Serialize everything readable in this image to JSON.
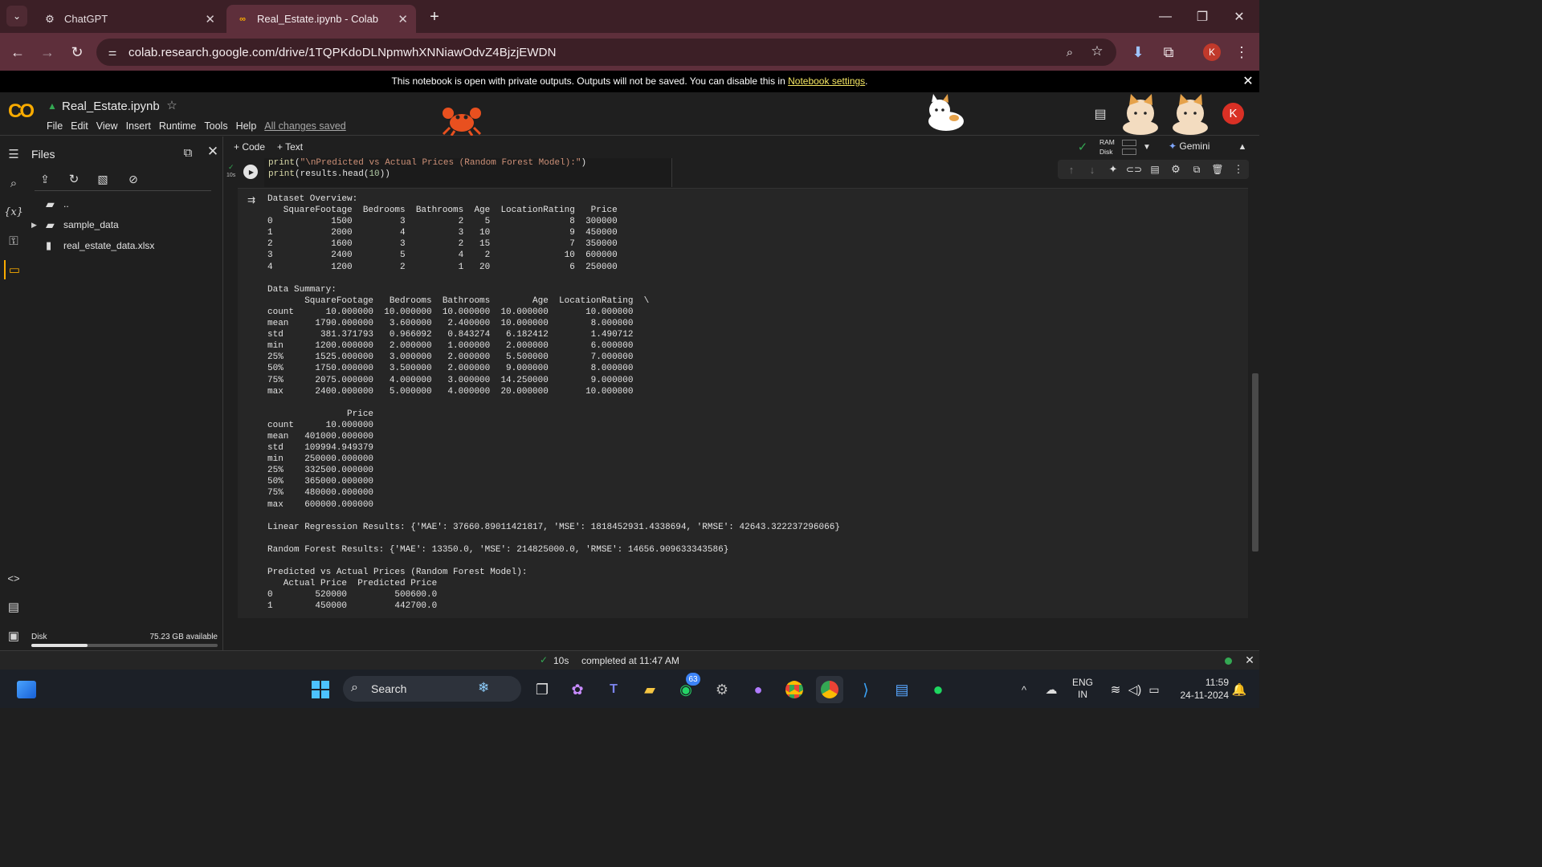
{
  "browser": {
    "tabs": [
      {
        "title": "ChatGPT",
        "active": false
      },
      {
        "title": "Real_Estate.ipynb - Colab",
        "active": true
      }
    ],
    "url": "colab.research.google.com/drive/1TQPKdoDLNpmwhXNNiawOdvZ4BjzjEWDN",
    "profile_initial": "K"
  },
  "banner": {
    "text": "This notebook is open with private outputs. Outputs will not be saved. You can disable this in ",
    "link": "Notebook settings",
    "suffix": "."
  },
  "colab": {
    "logo": "CO",
    "notebook_title": "Real_Estate.ipynb",
    "menu": [
      "File",
      "Edit",
      "View",
      "Insert",
      "Runtime",
      "Tools",
      "Help"
    ],
    "save_status": "All changes saved",
    "user_initial": "K",
    "toolbar": {
      "add_code": "+ Code",
      "add_text": "+ Text",
      "ram": "RAM",
      "disk": "Disk",
      "gemini": "Gemini"
    }
  },
  "files_panel": {
    "title": "Files",
    "items": [
      {
        "name": "..",
        "type": "parent"
      },
      {
        "name": "sample_data",
        "type": "folder"
      },
      {
        "name": "real_estate_data.xlsx",
        "type": "file"
      }
    ],
    "disk_label": "Disk",
    "disk_available": "75.23 GB available",
    "disk_used_fraction": 0.3
  },
  "cell": {
    "exec_time": "10s",
    "code_lines": [
      "print(\"\\nPredicted vs Actual Prices (Random Forest Model):\")",
      "print(results.head(10))"
    ],
    "output": "Dataset Overview:\n   SquareFootage  Bedrooms  Bathrooms  Age  LocationRating   Price\n0           1500         3          2    5               8  300000\n1           2000         4          3   10               9  450000\n2           1600         3          2   15               7  350000\n3           2400         5          4    2              10  600000\n4           1200         2          1   20               6  250000\n\nData Summary:\n       SquareFootage   Bedrooms  Bathrooms        Age  LocationRating  \\\ncount      10.000000  10.000000  10.000000  10.000000       10.000000   \nmean     1790.000000   3.600000   2.400000  10.000000        8.000000   \nstd       381.371793   0.966092   0.843274   6.182412        1.490712   \nmin      1200.000000   2.000000   1.000000   2.000000        6.000000   \n25%      1525.000000   3.000000   2.000000   5.500000        7.000000   \n50%      1750.000000   3.500000   2.000000   9.000000        8.000000   \n75%      2075.000000   4.000000   3.000000  14.250000        9.000000   \nmax      2400.000000   5.000000   4.000000  20.000000       10.000000   \n\n               Price  \ncount      10.000000  \nmean   401000.000000  \nstd    109994.949379  \nmin    250000.000000  \n25%    332500.000000  \n50%    365000.000000  \n75%    480000.000000  \nmax    600000.000000  \n\nLinear Regression Results: {'MAE': 37660.89011421817, 'MSE': 1818452931.4338694, 'RMSE': 42643.322237296066}\n\nRandom Forest Results: {'MAE': 13350.0, 'MSE': 214825000.0, 'RMSE': 14656.909633343586}\n\nPredicted vs Actual Prices (Random Forest Model):\n   Actual Price  Predicted Price\n0        520000         500600.0\n1        450000         442700.0"
  },
  "status_bar": {
    "time": "10s",
    "completed": "completed at 11:47 AM"
  },
  "taskbar": {
    "search": "Search",
    "whatsapp_badge": "63",
    "lang_1": "ENG",
    "lang_2": "IN",
    "clock_time": "11:59",
    "clock_date": "24-11-2024"
  },
  "colors": {
    "tab_strip": "#3c1f26",
    "toolbar": "#5e2f3b",
    "colab_bg": "#1f1f1f",
    "banner_link": "#f5e663",
    "colab_orange": "#f9ab00",
    "accent_green": "#34a853"
  }
}
